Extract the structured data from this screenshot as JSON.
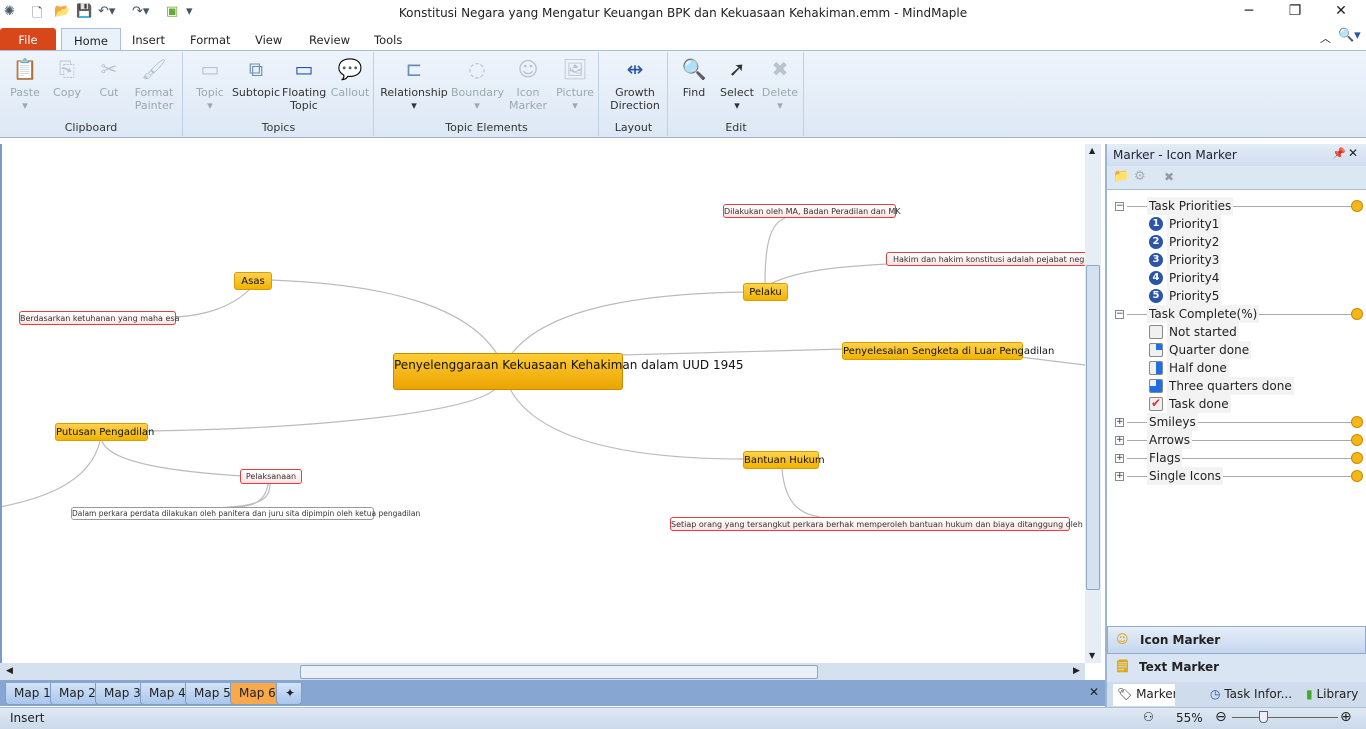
{
  "window": {
    "title": "Konstitusi Negara yang Mengatur Keuangan BPK dan Kekuasaan Kehakiman.emm - MindMaple"
  },
  "ribbon": {
    "tabs": [
      "File",
      "Home",
      "Insert",
      "Format",
      "View",
      "Review",
      "Tools"
    ],
    "active_tab": "Home",
    "groups": [
      {
        "label": "Clipboard",
        "buttons": [
          {
            "label": "Paste",
            "enabled": false
          },
          {
            "label": "Copy",
            "enabled": false
          },
          {
            "label": "Cut",
            "enabled": false
          },
          {
            "label": "Format Painter",
            "enabled": false
          }
        ]
      },
      {
        "label": "Topics",
        "buttons": [
          {
            "label": "Topic",
            "enabled": false
          },
          {
            "label": "Subtopic",
            "enabled": true
          },
          {
            "label": "Floating Topic",
            "enabled": true
          },
          {
            "label": "Callout",
            "enabled": false
          }
        ]
      },
      {
        "label": "Topic Elements",
        "buttons": [
          {
            "label": "Relationship",
            "enabled": true
          },
          {
            "label": "Boundary",
            "enabled": false
          },
          {
            "label": "Icon Marker",
            "enabled": false
          },
          {
            "label": "Picture",
            "enabled": false
          }
        ]
      },
      {
        "label": "Layout",
        "buttons": [
          {
            "label": "Growth Direction",
            "enabled": true
          }
        ]
      },
      {
        "label": "Edit",
        "buttons": [
          {
            "label": "Find",
            "enabled": true
          },
          {
            "label": "Select",
            "enabled": true
          },
          {
            "label": "Delete",
            "enabled": false
          }
        ]
      }
    ]
  },
  "map": {
    "central": "Penyelenggaraan Kekuasaan Kehakiman dalam UUD 1945",
    "asas": "Asas",
    "asas_detail": "Berdasarkan ketuhanan yang maha esa",
    "pelaku": "Pelaku",
    "pelaku_detail1": "Dilakukan oleh MA, Badan Peradilan dan MK",
    "pelaku_detail2": "Hakim dan hakim konstitusi adalah pejabat negara yan",
    "penyelesaian": "Penyelesaian Sengketa di Luar Pengadilan",
    "bantuan": "Bantuan Hukum",
    "bantuan_detail": "Setiap orang yang tersangkut perkara berhak memperoleh bantuan hukum dan biaya ditanggung oleh negara",
    "putusan": "Putusan Pengadilan",
    "pelaksanaan": "Pelaksanaan",
    "pelaksanaan_detail": "Dalam perkara perdata dilakukan oleh panitera dan juru sita dipimpin oleh ketua pengadilan"
  },
  "map_tabs": [
    "Map 1",
    "Map 2",
    "Map 3",
    "Map 4",
    "Map 5",
    "Map 6"
  ],
  "active_map_tab": "Map 6",
  "panel": {
    "title": "Marker - Icon Marker",
    "groups": [
      {
        "label": "Task Priorities",
        "expanded": true,
        "items": [
          "Priority1",
          "Priority2",
          "Priority3",
          "Priority4",
          "Priority5"
        ]
      },
      {
        "label": "Task Complete(%)",
        "expanded": true,
        "items": [
          "Not started",
          "Quarter done",
          "Half done",
          "Three quarters done",
          "Task done"
        ]
      },
      {
        "label": "Smileys",
        "expanded": false
      },
      {
        "label": "Arrows",
        "expanded": false
      },
      {
        "label": "Flags",
        "expanded": false
      },
      {
        "label": "Single Icons",
        "expanded": false
      }
    ],
    "buttons": [
      "Icon Marker",
      "Text Marker"
    ],
    "tabs": [
      "Marker - I...",
      "Task Infor...",
      "Library"
    ]
  },
  "status": {
    "mode": "Insert",
    "zoom": "55%",
    "zoom_fraction": 0.55
  },
  "colors": {
    "main_topic": "#f5b800",
    "subtopic_border": "#e04040",
    "file_tab": "#d8471a",
    "active_map_tab": "#f9a94a"
  }
}
